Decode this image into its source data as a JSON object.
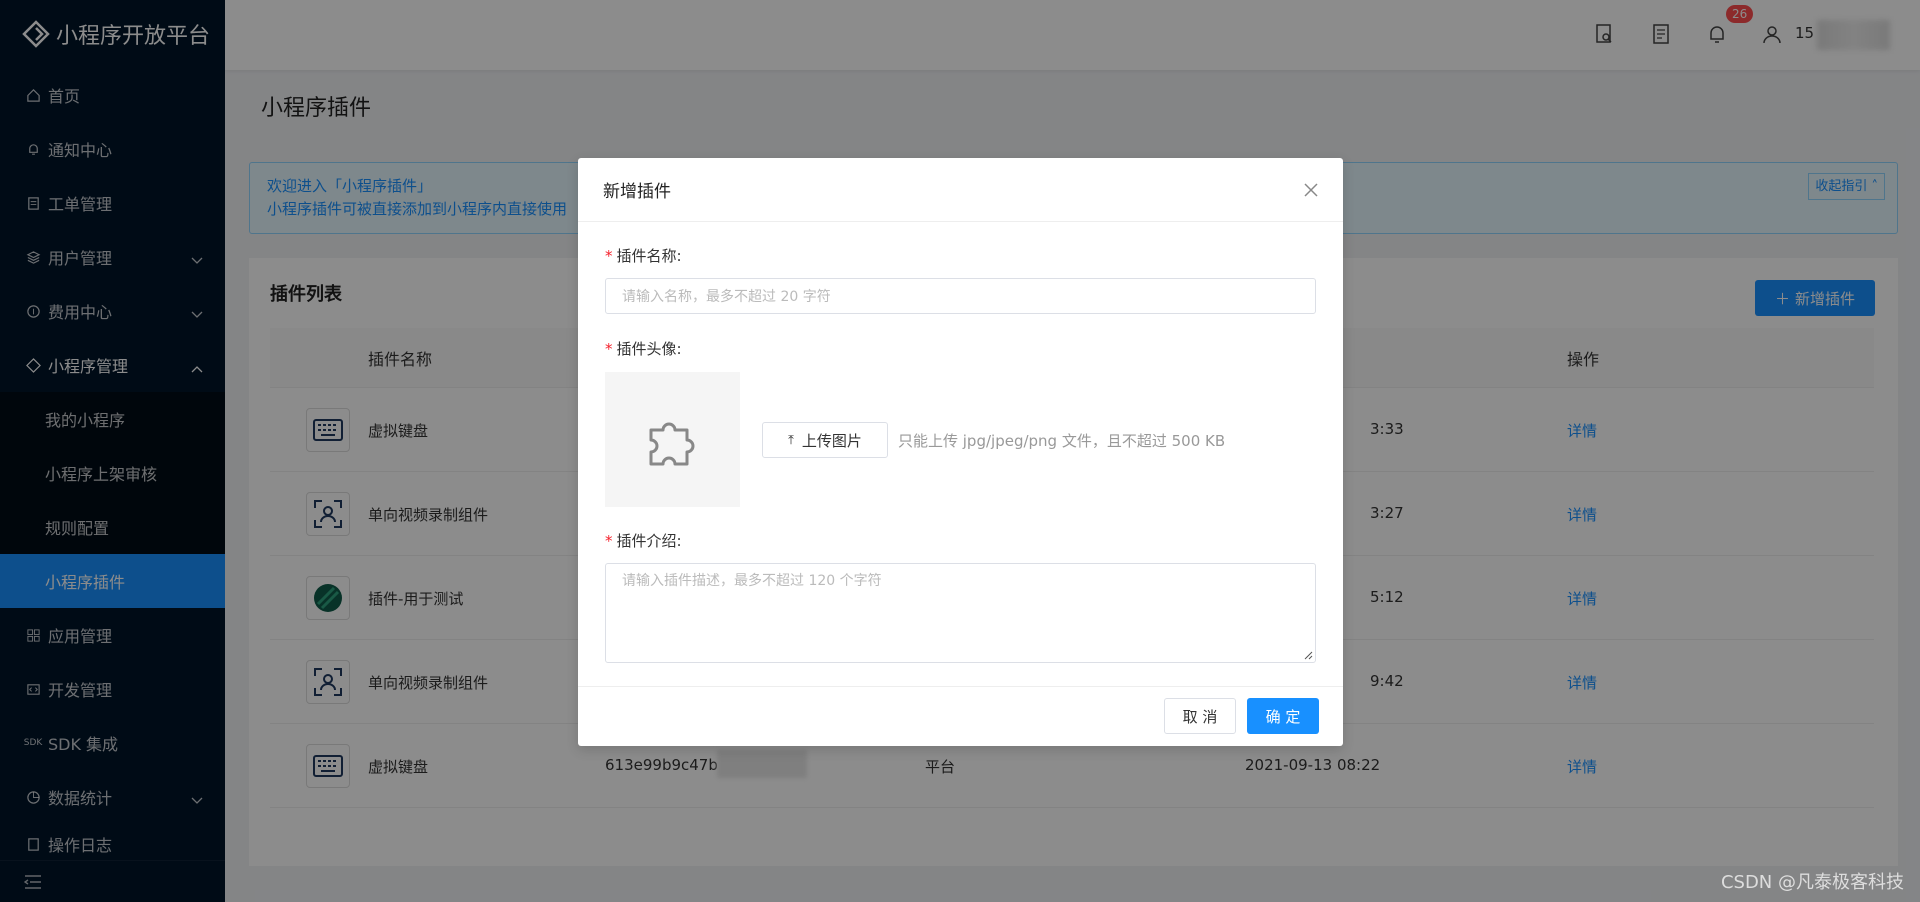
{
  "sidebar": {
    "brand": "小程序开放平台",
    "items": [
      {
        "label": "首页",
        "icon": "home-icon"
      },
      {
        "label": "通知中心",
        "icon": "bell-icon"
      },
      {
        "label": "工单管理",
        "icon": "document-icon"
      },
      {
        "label": "用户管理",
        "icon": "layers-icon"
      },
      {
        "label": "费用中心",
        "icon": "coin-icon"
      },
      {
        "label": "小程序管理",
        "icon": "diamond-icon"
      },
      {
        "label": "我的小程序"
      },
      {
        "label": "小程序上架审核"
      },
      {
        "label": "规则配置"
      },
      {
        "label": "小程序插件"
      },
      {
        "label": "应用管理",
        "icon": "grid-icon"
      },
      {
        "label": "开发管理",
        "icon": "code-icon"
      },
      {
        "label": "SDK 集成",
        "icon": "sdk-icon"
      },
      {
        "label": "数据统计",
        "icon": "pie-icon"
      },
      {
        "label": "操作日志",
        "icon": "log-icon"
      }
    ]
  },
  "header": {
    "notification_count": "26",
    "username": "15"
  },
  "page": {
    "title": "小程序插件",
    "info_line1": "欢迎进入「小程序插件」",
    "info_line2": "小程序插件可被直接添加到小程序内直接使用",
    "collapse_label": "收起指引"
  },
  "table": {
    "title": "插件列表",
    "add_label": "新增插件",
    "col_name": "插件名称",
    "col_action": "操作",
    "rows": [
      {
        "name": "虚拟键盘",
        "time": "3:33",
        "action": "详情"
      },
      {
        "name": "单向视频录制组件",
        "time": "3:27",
        "action": "详情"
      },
      {
        "name": "插件-用于测试",
        "time": "5:12",
        "action": "详情"
      },
      {
        "name": "单向视频录制组件",
        "time": "9:42",
        "action": "详情"
      },
      {
        "name": "虚拟键盘",
        "id": "613e99b9c47b",
        "type": "平台",
        "time": "2021-09-13 08:22",
        "action": "详情"
      }
    ]
  },
  "modal": {
    "title": "新增插件",
    "name_label": "插件名称:",
    "name_placeholder": "请输入名称，最多不超过 20 字符",
    "avatar_label": "插件头像:",
    "upload_label": "上传图片",
    "upload_hint": "只能上传 jpg/jpeg/png 文件，且不超过 500 KB",
    "desc_label": "插件介绍:",
    "desc_placeholder": "请输入插件描述，最多不超过 120 个字符",
    "cancel_label": "取 消",
    "ok_label": "确 定"
  },
  "watermark": "CSDN @凡泰极客科技",
  "colors": {
    "primary": "#1890ff",
    "sidebar": "#001529",
    "danger": "#ff4d4f"
  }
}
